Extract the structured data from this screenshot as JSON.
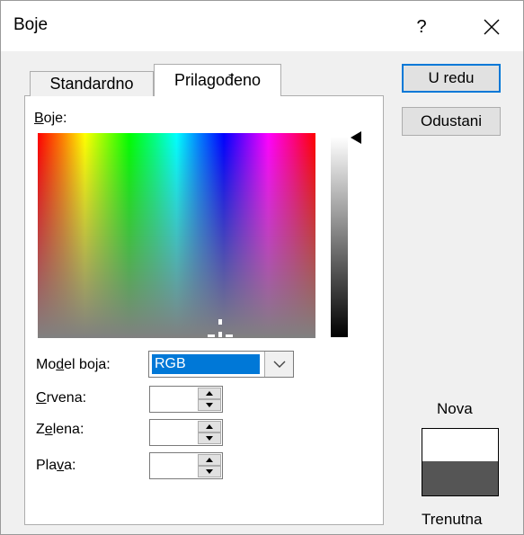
{
  "window": {
    "title": "Boje",
    "help_label": "?",
    "close_icon": "close-icon"
  },
  "tabs": [
    {
      "label": "Standardno",
      "active": false
    },
    {
      "label": "Prilagođeno",
      "active": true
    }
  ],
  "colors_section": {
    "label_mnemonic": "B",
    "label_rest": "oje:"
  },
  "model_field": {
    "label_pre": "Mo",
    "label_mnemonic": "d",
    "label_post": "el boja:",
    "selected": "RGB"
  },
  "red_field": {
    "label_mnemonic": "C",
    "label_post": "rvena:",
    "value": ""
  },
  "green_field": {
    "label_pre": "Z",
    "label_mnemonic": "e",
    "label_post": "lena:",
    "value": ""
  },
  "blue_field": {
    "label_pre": "Pla",
    "label_mnemonic": "v",
    "label_post": "a:",
    "value": ""
  },
  "buttons": {
    "ok": "U redu",
    "cancel": "Odustani"
  },
  "preview": {
    "new_label": "Nova",
    "current_label": "Trenutna",
    "new_color": "#ffffff",
    "current_color": "#555555"
  },
  "colors": {
    "accent": "#0078d7",
    "dialog_bg": "#f0f0f0"
  }
}
